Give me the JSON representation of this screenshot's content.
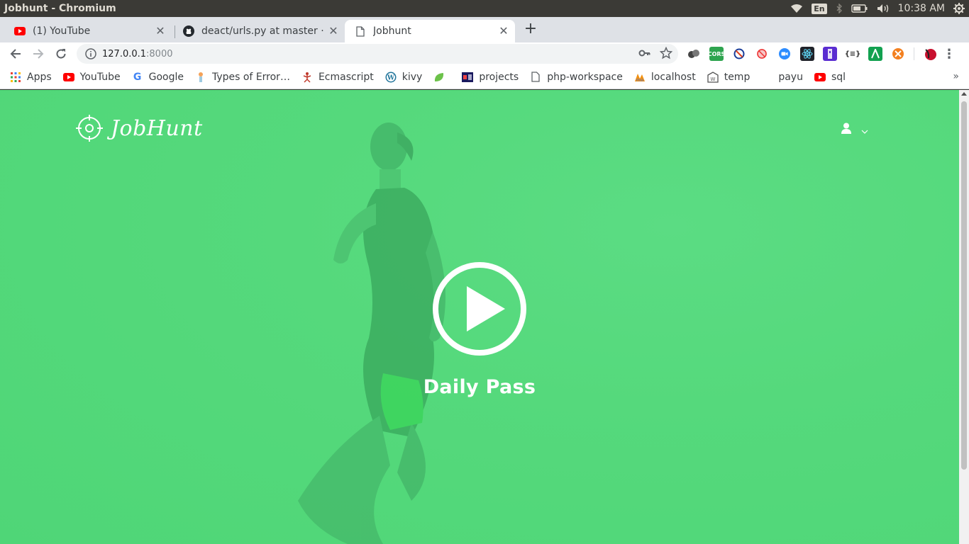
{
  "os": {
    "window_title": "Jobhunt - Chromium",
    "input_lang": "En",
    "clock": "10:38 AM"
  },
  "tabs": [
    {
      "label": "(1) YouTube",
      "icon": "youtube-icon"
    },
    {
      "label": "deact/urls.py at master · r",
      "icon": "github-icon"
    },
    {
      "label": "Jobhunt",
      "icon": "page-icon"
    }
  ],
  "toolbar": {
    "url_host": "127.0.0.1",
    "url_port": ":8000"
  },
  "bookmarks": [
    {
      "label": "Apps",
      "icon": "apps-grid-icon"
    },
    {
      "label": "YouTube",
      "icon": "youtube-icon"
    },
    {
      "label": "Google",
      "icon": "google-icon"
    },
    {
      "label": "Types of Error…",
      "icon": "bookmark-icon"
    },
    {
      "label": "Ecmascript",
      "icon": "ecmascript-icon"
    },
    {
      "label": "kivy",
      "icon": "wordpress-icon"
    },
    {
      "label": "",
      "icon": "leaf-icon"
    },
    {
      "label": "projects",
      "icon": "projects-icon"
    },
    {
      "label": "php-workspace",
      "icon": "page-icon"
    },
    {
      "label": "localhost",
      "icon": "phpmyadmin-icon"
    },
    {
      "label": "temp",
      "icon": "temp-icon"
    },
    {
      "label": "payu",
      "icon": "blank-icon"
    },
    {
      "label": "sql",
      "icon": "youtube-icon"
    }
  ],
  "page": {
    "logo_text": "JobHunt",
    "hero_title": "Daily Pass",
    "overlay_color": "#4fd677"
  }
}
